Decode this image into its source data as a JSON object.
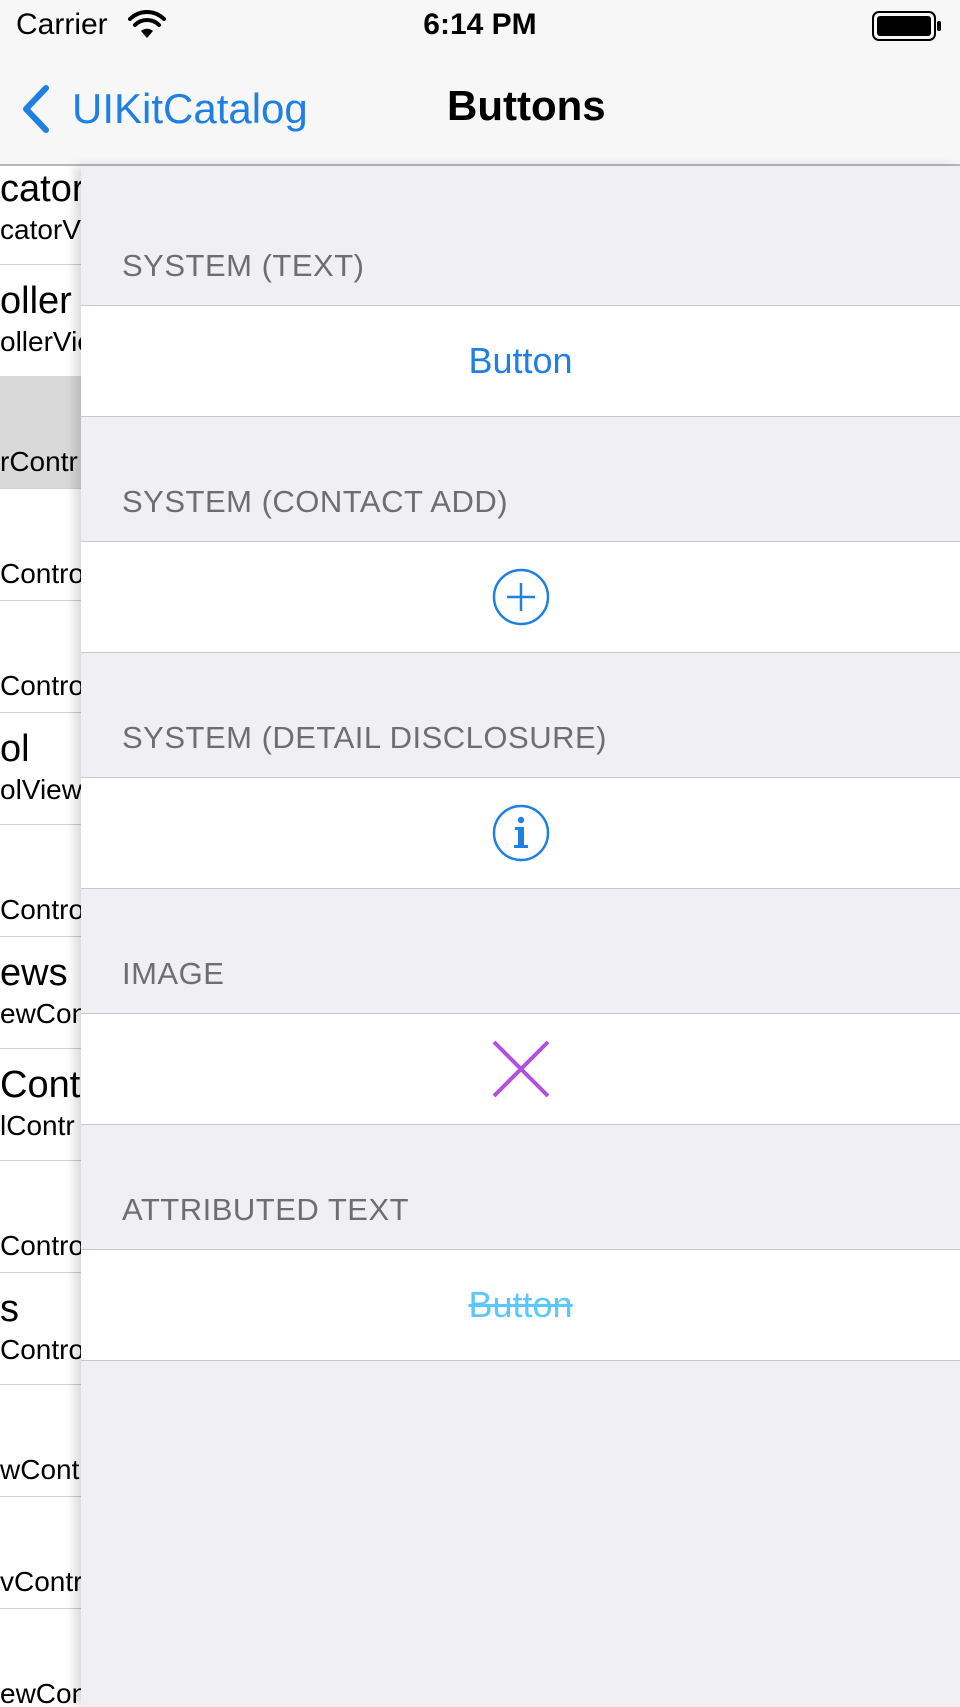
{
  "status_bar": {
    "carrier": "Carrier",
    "time": "6:14 PM"
  },
  "nav": {
    "back_label": "UIKitCatalog",
    "title": "Buttons"
  },
  "master_list": [
    {
      "title": "cator",
      "subtitle": "catorV"
    },
    {
      "title": "oller",
      "subtitle": "ollerVie"
    },
    {
      "title": "",
      "subtitle": "rContr"
    },
    {
      "title": "",
      "subtitle": "Contro"
    },
    {
      "title": "",
      "subtitle": "Contro"
    },
    {
      "title": "ol",
      "subtitle": "olView"
    },
    {
      "title": "",
      "subtitle": "Contro"
    },
    {
      "title": "ews",
      "subtitle": "ewCon"
    },
    {
      "title": "Cont",
      "subtitle": "lContr"
    },
    {
      "title": "",
      "subtitle": "Contro"
    },
    {
      "title": "s",
      "subtitle": "Contro"
    },
    {
      "title": "",
      "subtitle": "wCont"
    },
    {
      "title": "",
      "subtitle": "vContr"
    },
    {
      "title": "",
      "subtitle": "ewCon"
    }
  ],
  "sections": {
    "system_text": {
      "header": "SYSTEM (TEXT)",
      "button_label": "Button"
    },
    "contact_add": {
      "header": "SYSTEM (CONTACT ADD)",
      "icon": "plus-circle-icon"
    },
    "detail_disclosure": {
      "header": "SYSTEM (DETAIL DISCLOSURE)",
      "icon": "info-circle-icon"
    },
    "image": {
      "header": "IMAGE",
      "icon": "x-icon"
    },
    "attributed_text": {
      "header": "ATTRIBUTED TEXT",
      "button_label": "Button"
    }
  },
  "colors": {
    "tint": "#1f7fe3",
    "image_tint": "#af52de",
    "attributed": "#5ac8fa"
  }
}
